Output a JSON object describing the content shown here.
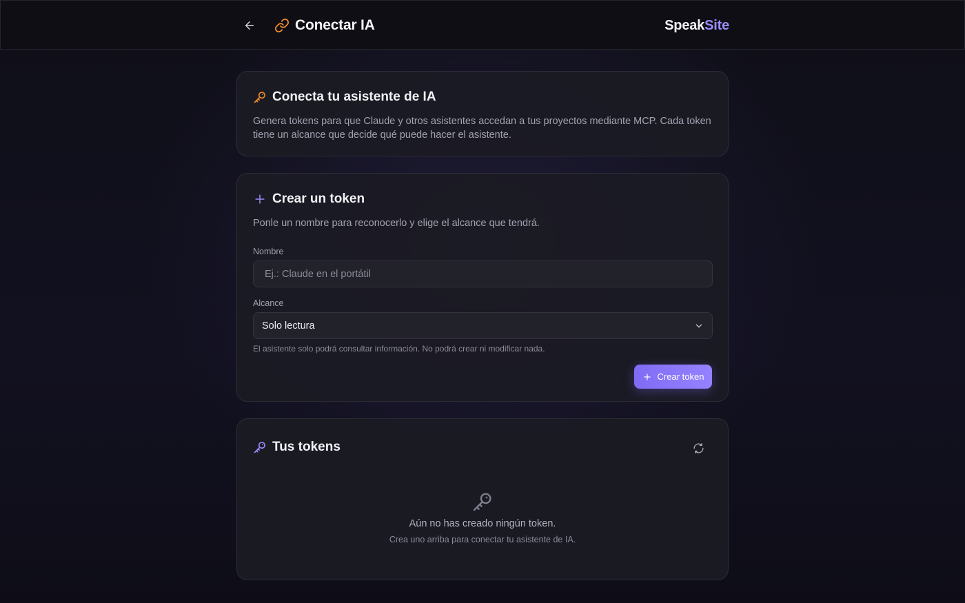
{
  "header": {
    "title": "Conectar IA",
    "brand_part1": "Speak",
    "brand_part2": "Site",
    "icons": {
      "back": "arrow-left-icon",
      "title": "link-icon"
    }
  },
  "intro_card": {
    "title": "Conecta tu asistente de IA",
    "description": "Genera tokens para que Claude y otros asistentes accedan a tus proyectos mediante MCP. Cada token tiene un alcance que decide qué puede hacer el asistente.",
    "icon": "key-icon"
  },
  "create_card": {
    "title": "Crear un token",
    "subtitle": "Ponle un nombre para reconocerlo y elige el alcance que tendrá.",
    "icon": "plus-icon",
    "name_label": "Nombre",
    "name_placeholder": "Ej.: Claude en el portátil",
    "name_value": "",
    "scope_label": "Alcance",
    "scope_selected": "Solo lectura",
    "scope_hint": "El asistente solo podrá consultar información. No podrá crear ni modificar nada.",
    "submit_label": "Crear token"
  },
  "tokens_card": {
    "title": "Tus tokens",
    "icon": "key-icon",
    "refresh_icon": "refresh-icon",
    "empty_title": "Aún no has creado ningún token.",
    "empty_subtitle": "Crea uno arriba para conectar tu asistente de IA."
  },
  "colors": {
    "accent": "#8b78fb",
    "brand_accent": "#9b8cff",
    "orange_icon": "#f08a2c",
    "card_bg": "#1b1b24",
    "page_bg": "#121120"
  }
}
